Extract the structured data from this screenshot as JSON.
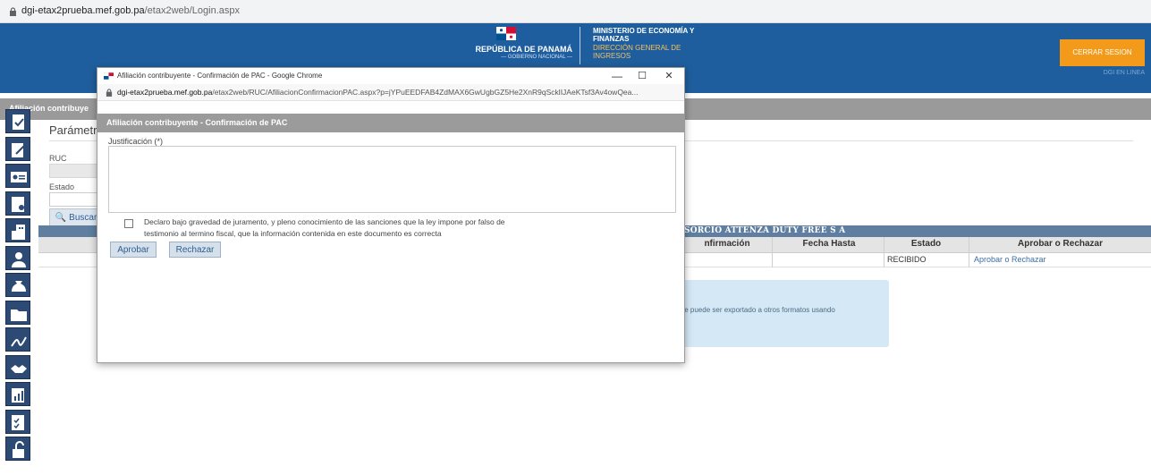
{
  "browser": {
    "url_domain": "dgi-etax2prueba.mef.gob.pa",
    "url_path": "/etax2web/Login.aspx"
  },
  "header": {
    "republic": "REPÚBLICA DE PANAMÁ",
    "republic_sub": "— GOBIERNO NACIONAL —",
    "ministry": "MINISTERIO DE ECONOMÍA Y FINANZAS",
    "direction": "DIRECCIÓN GENERAL DE INGRESOS",
    "logout_label": "CERRAR SESION",
    "online_label": "DGI EN LINEA"
  },
  "page": {
    "bar_title": "Afiliación contribuye",
    "params_title": "Parámetro",
    "ruc_label": "RUC",
    "estado_label": "Estado",
    "search_label": "Buscar",
    "info_text": "te puede ser exportado a otros formatos usando"
  },
  "grid": {
    "title": "SORCIO ATTENZA DUTY FREE S A",
    "columns": [
      "nfirmación",
      "Fecha Hasta",
      "Estado",
      "Aprobar o Rechazar"
    ],
    "row": {
      "estado": "RECIBIDO",
      "accion": "Aprobar o Rechazar"
    }
  },
  "popup": {
    "window_title": "Afiliación contribuyente - Confirmación de PAC - Google Chrome",
    "url_domain": "dgi-etax2prueba.mef.gob.pa",
    "url_path": "/etax2web/RUC/AfiliacionConfirmacionPAC.aspx?p=jYPuEEDFAB4ZdMAX6GwUgbGZ5He2XnR9qScklIJAeKTsf3Av4owQea...",
    "section_title": "Afiliación contribuyente - Confirmación de PAC",
    "justification_label": "Justificación (*)",
    "justification_value": "",
    "declaration": "Declaro bajo gravedad de juramento, y pleno conocimiento de las sanciones que la ley impone por falso de testimonio al termino fiscal, que la información contenida en este documento es correcta",
    "approve_label": "Aprobar",
    "reject_label": "Rechazar",
    "minimize": "—",
    "maximize": "☐",
    "close": "✕"
  },
  "colors": {
    "header_blue": "#1f5e9e",
    "logout_orange": "#f39a1b",
    "sidebar_blue": "#2c4a73",
    "grid_title": "#5f7ea0"
  },
  "sidebar_icons": [
    "check-doc-icon",
    "edit-doc-icon",
    "id-card-icon",
    "certificate-icon",
    "building-icon",
    "user-icon",
    "money-bag-icon",
    "folder-icon",
    "signature-icon",
    "handshake-icon",
    "report-icon",
    "checklist-icon",
    "unlock-icon"
  ]
}
